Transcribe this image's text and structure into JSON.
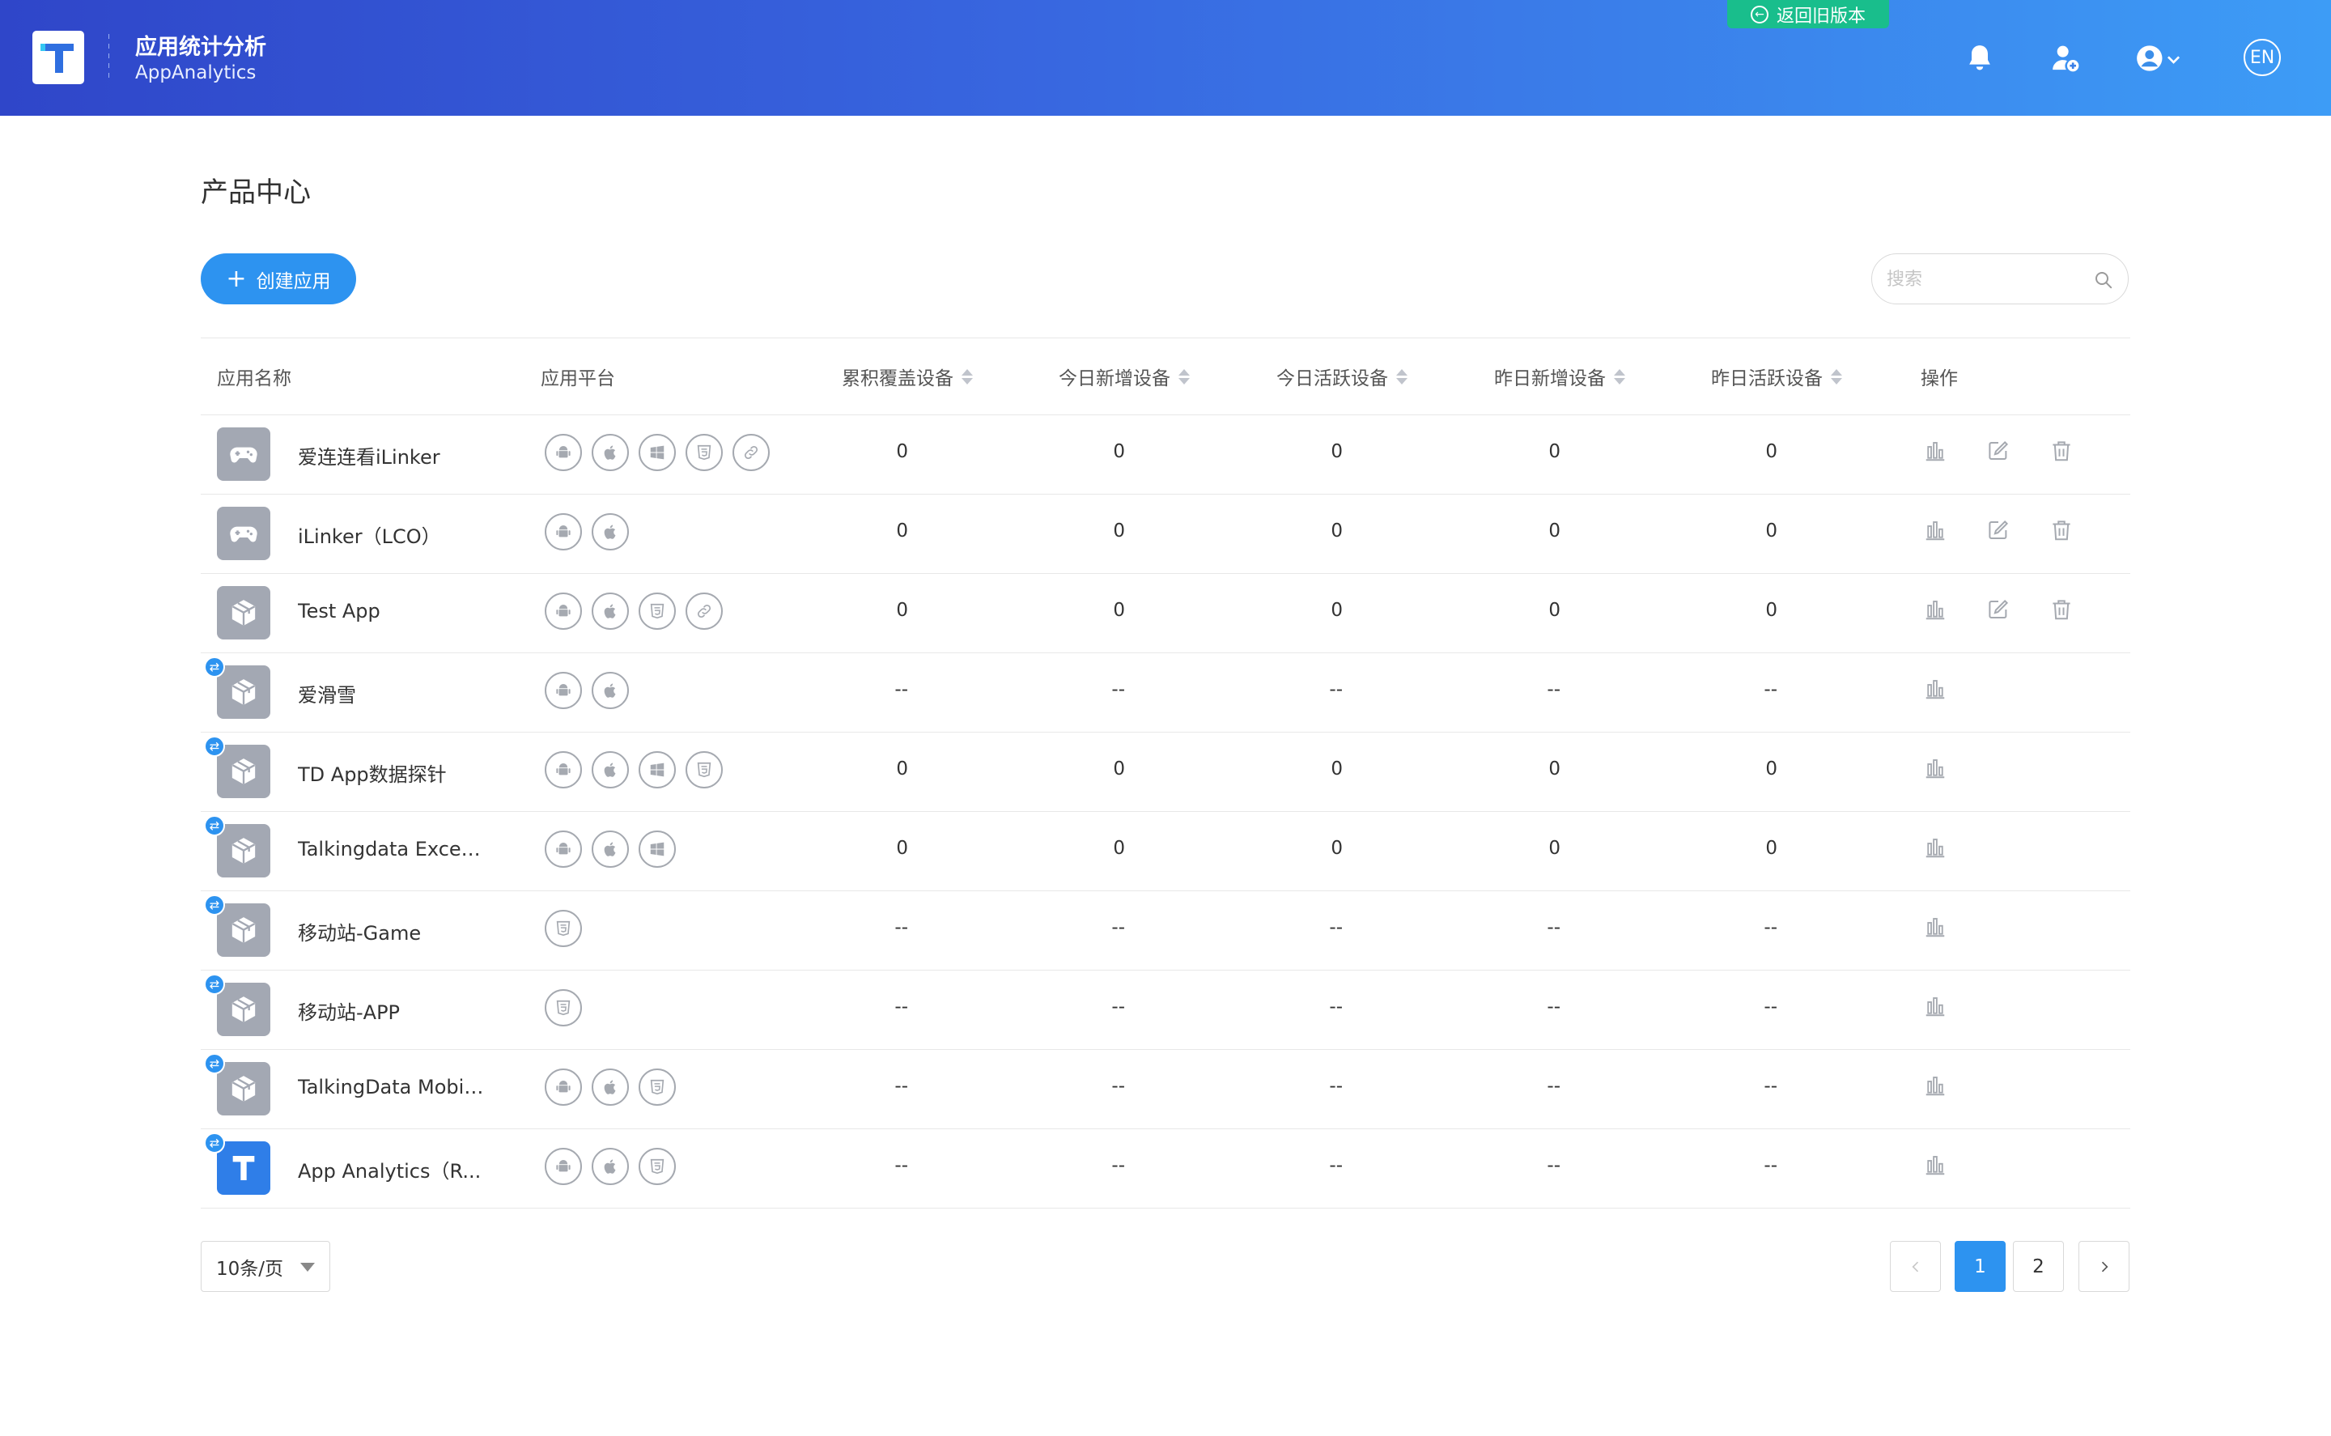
{
  "header": {
    "app_title": "应用统计分析",
    "app_subtitle": "AppAnalytics",
    "old_version_label": "返回旧版本",
    "language_label": "EN"
  },
  "page": {
    "title": "产品中心",
    "create_button_label": "创建应用",
    "search_placeholder": "搜索"
  },
  "table": {
    "columns": [
      "应用名称",
      "应用平台",
      "累积覆盖设备",
      "今日新增设备",
      "今日活跃设备",
      "昨日新增设备",
      "昨日活跃设备",
      "操作"
    ],
    "rows": [
      {
        "name": "爱连连看iLinker",
        "icon": "gamepad-icon",
        "shared": false,
        "platforms": [
          "android",
          "ios",
          "windows",
          "html5",
          "link"
        ],
        "values": [
          "0",
          "0",
          "0",
          "0",
          "0"
        ],
        "ops": [
          "stats",
          "edit",
          "delete"
        ]
      },
      {
        "name": "iLinker（LCO）",
        "icon": "gamepad-icon",
        "shared": false,
        "platforms": [
          "android",
          "ios"
        ],
        "values": [
          "0",
          "0",
          "0",
          "0",
          "0"
        ],
        "ops": [
          "stats",
          "edit",
          "delete"
        ]
      },
      {
        "name": "Test App",
        "icon": "box-icon",
        "shared": false,
        "platforms": [
          "android",
          "ios",
          "html5",
          "link"
        ],
        "values": [
          "0",
          "0",
          "0",
          "0",
          "0"
        ],
        "ops": [
          "stats",
          "edit",
          "delete"
        ]
      },
      {
        "name": "爱滑雪",
        "icon": "box-icon",
        "shared": true,
        "platforms": [
          "android",
          "ios"
        ],
        "values": [
          "--",
          "--",
          "--",
          "--",
          "--"
        ],
        "ops": [
          "stats"
        ]
      },
      {
        "name": "TD App数据探针",
        "icon": "box-icon",
        "shared": true,
        "platforms": [
          "android",
          "ios",
          "windows",
          "html5"
        ],
        "values": [
          "0",
          "0",
          "0",
          "0",
          "0"
        ],
        "ops": [
          "stats"
        ]
      },
      {
        "name": "Talkingdata Excep...",
        "icon": "box-icon",
        "shared": true,
        "platforms": [
          "android",
          "ios",
          "windows"
        ],
        "values": [
          "0",
          "0",
          "0",
          "0",
          "0"
        ],
        "ops": [
          "stats"
        ]
      },
      {
        "name": "移动站-Game",
        "icon": "box-icon",
        "shared": true,
        "platforms": [
          "html5"
        ],
        "values": [
          "--",
          "--",
          "--",
          "--",
          "--"
        ],
        "ops": [
          "stats"
        ]
      },
      {
        "name": "移动站-APP",
        "icon": "box-icon",
        "shared": true,
        "platforms": [
          "html5"
        ],
        "values": [
          "--",
          "--",
          "--",
          "--",
          "--"
        ],
        "ops": [
          "stats"
        ]
      },
      {
        "name": "TalkingData Mobil...",
        "icon": "box-icon",
        "shared": true,
        "platforms": [
          "android",
          "ios",
          "html5"
        ],
        "values": [
          "--",
          "--",
          "--",
          "--",
          "--"
        ],
        "ops": [
          "stats"
        ]
      },
      {
        "name": "App Analytics（R...",
        "icon": "brand-t-icon",
        "shared": true,
        "platforms": [
          "android",
          "ios",
          "html5"
        ],
        "values": [
          "--",
          "--",
          "--",
          "--",
          "--"
        ],
        "ops": [
          "stats"
        ]
      }
    ]
  },
  "pagination": {
    "page_size_label": "10条/页",
    "pages": [
      "1",
      "2"
    ],
    "current_page": "1"
  },
  "colors": {
    "header_gradient_start": "#2f46c9",
    "header_gradient_end": "#3d9cf6",
    "accent": "#2d93f0",
    "old_version_bg": "#19be8c",
    "icon_gray": "#a3a8b3"
  }
}
